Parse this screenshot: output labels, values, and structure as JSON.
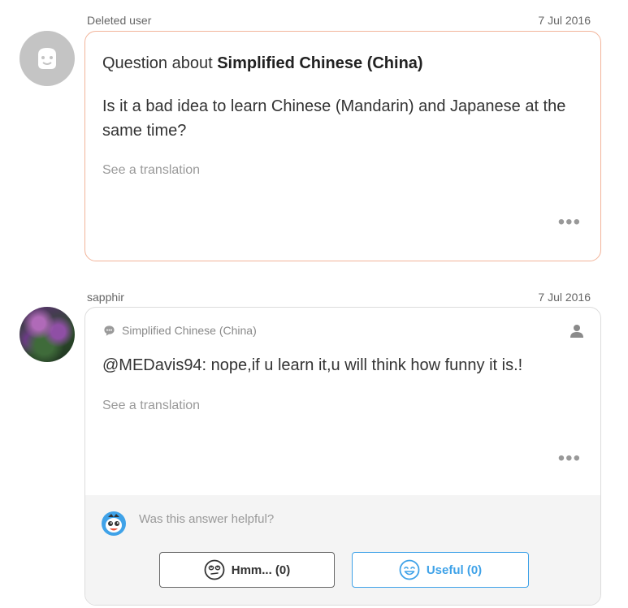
{
  "question": {
    "author": "Deleted user",
    "date": "7 Jul 2016",
    "title_prefix": "Question about ",
    "title_language": "Simplified Chinese (China)",
    "body": "Is it a bad idea to learn Chinese (Mandarin) and Japanese at the same time?",
    "see_translation": "See a translation",
    "more": "•••"
  },
  "answer": {
    "author": "sapphir",
    "date": "7 Jul 2016",
    "language": "Simplified Chinese (China)",
    "body": "@MEDavis94: nope,if u learn it,u will think how funny it is.!",
    "see_translation": "See a translation",
    "more": "•••",
    "helpful_prompt": "Was this answer helpful?",
    "hmm_label": "Hmm... (0)",
    "useful_label": "Useful (0)"
  },
  "colors": {
    "question_border": "#f2b49a",
    "useful_blue": "#3fa2e8",
    "footer_bg": "#f4f4f4"
  },
  "icons": [
    "deleted-user-avatar-icon",
    "speech-bubble-icon",
    "person-icon",
    "mascot-icon",
    "hmm-face-icon",
    "smile-face-icon",
    "more-dots-icon"
  ]
}
